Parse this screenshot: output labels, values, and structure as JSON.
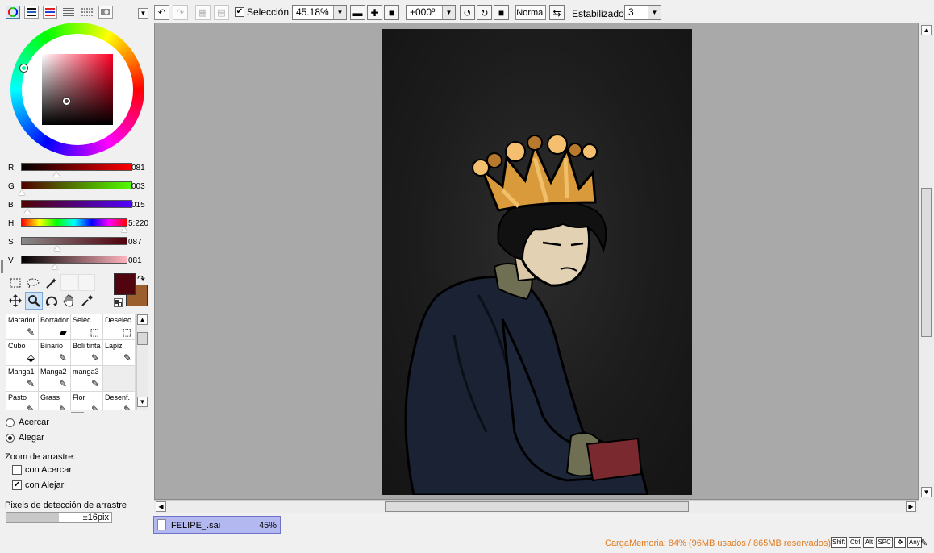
{
  "color_panel": {
    "sliders": [
      {
        "label": "R",
        "value": "081",
        "gradient": "linear-gradient(to right,#000,#ff0000)",
        "pos": 0.32
      },
      {
        "label": "G",
        "value": "003",
        "gradient": "linear-gradient(to right,#510000,#51ff00)",
        "pos": 0.01
      },
      {
        "label": "B",
        "value": "015",
        "gradient": "linear-gradient(to right,#510300,#5103ff)",
        "pos": 0.06
      },
      {
        "label": "H",
        "value": "5:220",
        "gradient": "linear-gradient(to right,#f00,#ff0,#0f0,#0ff,#00f,#f0f,#f00)",
        "pos": 0.97
      },
      {
        "label": "S",
        "value": "087",
        "gradient": "linear-gradient(to right,#8a8a8a,#51000c)",
        "pos": 0.34
      },
      {
        "label": "V",
        "value": "081",
        "gradient": "linear-gradient(to right,#000,#ffb3bd)",
        "pos": 0.32
      }
    ],
    "primary_color": "#51030f",
    "secondary_color": "#9a5f2c",
    "icons": [
      "color-wheel-icon",
      "rgb-slider-icon",
      "hsv-slider-icon",
      "swatch-icon",
      "palette-icon",
      "scratchpad-icon"
    ]
  },
  "tools": [
    "rect-select-icon",
    "lasso-icon",
    "magic-wand-icon",
    "move-icon",
    "zoom-icon",
    "rotate-icon",
    "hand-icon",
    "eyedropper-icon"
  ],
  "brushes": [
    {
      "label": "Marador"
    },
    {
      "label": "Borrador"
    },
    {
      "label": "Selec."
    },
    {
      "label": "Deselec."
    },
    {
      "label": "Cubo"
    },
    {
      "label": "Binario"
    },
    {
      "label": "Boli tinta"
    },
    {
      "label": "Lapiz"
    },
    {
      "label": "Manga1"
    },
    {
      "label": "Manga2"
    },
    {
      "label": "manga3"
    },
    {
      "label": ""
    },
    {
      "label": "Pasto"
    },
    {
      "label": "Grass"
    },
    {
      "label": "Flor"
    },
    {
      "label": "Desenf."
    }
  ],
  "options": {
    "zoom_in": "Acercar",
    "zoom_out": "Alegar",
    "drag_zoom_title": "Zoom de arrastre:",
    "drag_with_zoom_in": "con Acercar",
    "drag_with_zoom_out": "con Alejar",
    "drag_pixels_title": "Pixels de detección de arrastre",
    "drag_pixels_value": "±16pix",
    "drag_pixels_fraction": 0.5
  },
  "toolbar": {
    "selection_label": "Selección",
    "zoom_value": "45.18%",
    "rotation_value": "+000º",
    "blend_mode": "Normal",
    "stabilizer_label": "Estabilizador",
    "stabilizer_value": "3"
  },
  "document_tab": {
    "filename": "FELIPE_.sai",
    "zoom": "45%"
  },
  "status": {
    "memory": "CargaMemoria: 84% (96MB usados / 865MB reservados)",
    "keys": [
      "Shift",
      "Ctrl",
      "Alt",
      "SPC",
      "",
      "Any"
    ]
  }
}
